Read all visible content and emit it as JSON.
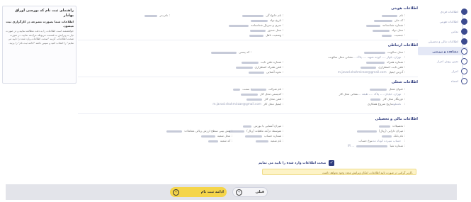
{
  "stepper": {
    "steps": [
      {
        "label": "اطلاعات فردی",
        "state": "done"
      },
      {
        "label": "اطلاعات هویتی",
        "state": "done"
      },
      {
        "label": "تماس",
        "state": "done"
      },
      {
        "label": "اطلاعات مالی و تحصیلی",
        "state": "done"
      },
      {
        "label": "مشاهده و بررسی",
        "state": "active"
      },
      {
        "label": "تعیین روش احراز",
        "state": "todo"
      },
      {
        "label": "احراز",
        "state": "todo"
      },
      {
        "label": "امضاء",
        "state": "todo"
      }
    ]
  },
  "help": {
    "title": "راهنمای ثبت نام کد بورسی اوراق بهادار",
    "subtitle": "اطلاعات شما بصورت مصرحه در کارگزاری ثبت میشود.",
    "body": "خواهشمند است اطلاعات را به دقت مطالعه نمایید و در صورت نیاز به ویرایش به قسمت مربوطه مراجعه نمایید. در صورت صحت اطلاعات، گزینه \"صحت اطلاعات وارد شده را تایید می نمایم\" را انتخاب کنید و سپس دکمه \"ادامه ثبت نام\" را بزنید."
  },
  "sections": {
    "identity": {
      "title": "اطلاعات هویتی",
      "labels": [
        "نام :",
        "کد ملی :",
        "شماره شناسنامه :",
        "محل تولد :",
        "جنسیت :",
        "نام خانوادگی :",
        "تاریخ تولد :",
        "سری و سریال شناسنامه :",
        "محل صدور :",
        "وضعیت تاهل :",
        "نام پدر :"
      ]
    },
    "contact": {
      "title": "اطلاعات ارتباطی",
      "labels": [
        "محل سکونت :",
        "نشانی محل سکونت :",
        "شماره همراه :",
        "تلفن ثابت اضطراری :",
        "آدرس ایمیل :",
        "شماره تلفن ثابت :",
        "تلفن همراه اضطراری :",
        "نحوه آشنایی :",
        "کد پستی :"
      ],
      "address": "تهران، بلوار ...، کوچه شهید ...، پلاک ...",
      "email": "m.javad.shahmirzae@gmail.com"
    },
    "job": {
      "title": "اطلاعات شغلی",
      "labels": [
        "عنوان شغل :",
        "نشانی محل کار :",
        "دورنگار محل کار :",
        "تاریخ شروع همکاری :",
        "نام شرکت :",
        "کدپستی محل کار :",
        "تلفن محل کار :",
        "ایمیل محل کار :",
        "سمت :"
      ],
      "address": "تهران، خیابان ...، پلاک ...، طبقه ...",
      "email": "m.javad.shahmirzae@gmail.com",
      "start_date": "نامعلوم"
    },
    "finance": {
      "title": "اطلاعات مالی و تحصیلی",
      "labels": [
        "تحصیلات :",
        "میزان دارایی (ریال) :",
        "نام بانک :",
        "نوع حساب :",
        "شماره شبا :",
        "میزان آشنایی با بورس :",
        "متوسط درآمد ماهیانه (ریال) :",
        "شماره حساب :",
        "نام شعبه :",
        "پیش بینی سطح ارزش ریالی معاملات :",
        "محل شعبه :",
        "کد شعبه :"
      ],
      "account_type": "حساب سپرده کوتاه مدت",
      "sheba": "IR ..."
    }
  },
  "confirm": {
    "label": "صحت اطلاعات وارد شده را تایید می نمایم",
    "notice": "کاربر گرامی در صورت تایید اطلاعات، امکان ویرایش مجدد وجود نخواهد داشت."
  },
  "actions": {
    "next_label": "ادامه ثبت نام",
    "prev_label": "قبلی"
  },
  "colors": {
    "primary": "#2d3a7c",
    "accent": "#f5d54a",
    "bar": "#e3e4ea"
  }
}
